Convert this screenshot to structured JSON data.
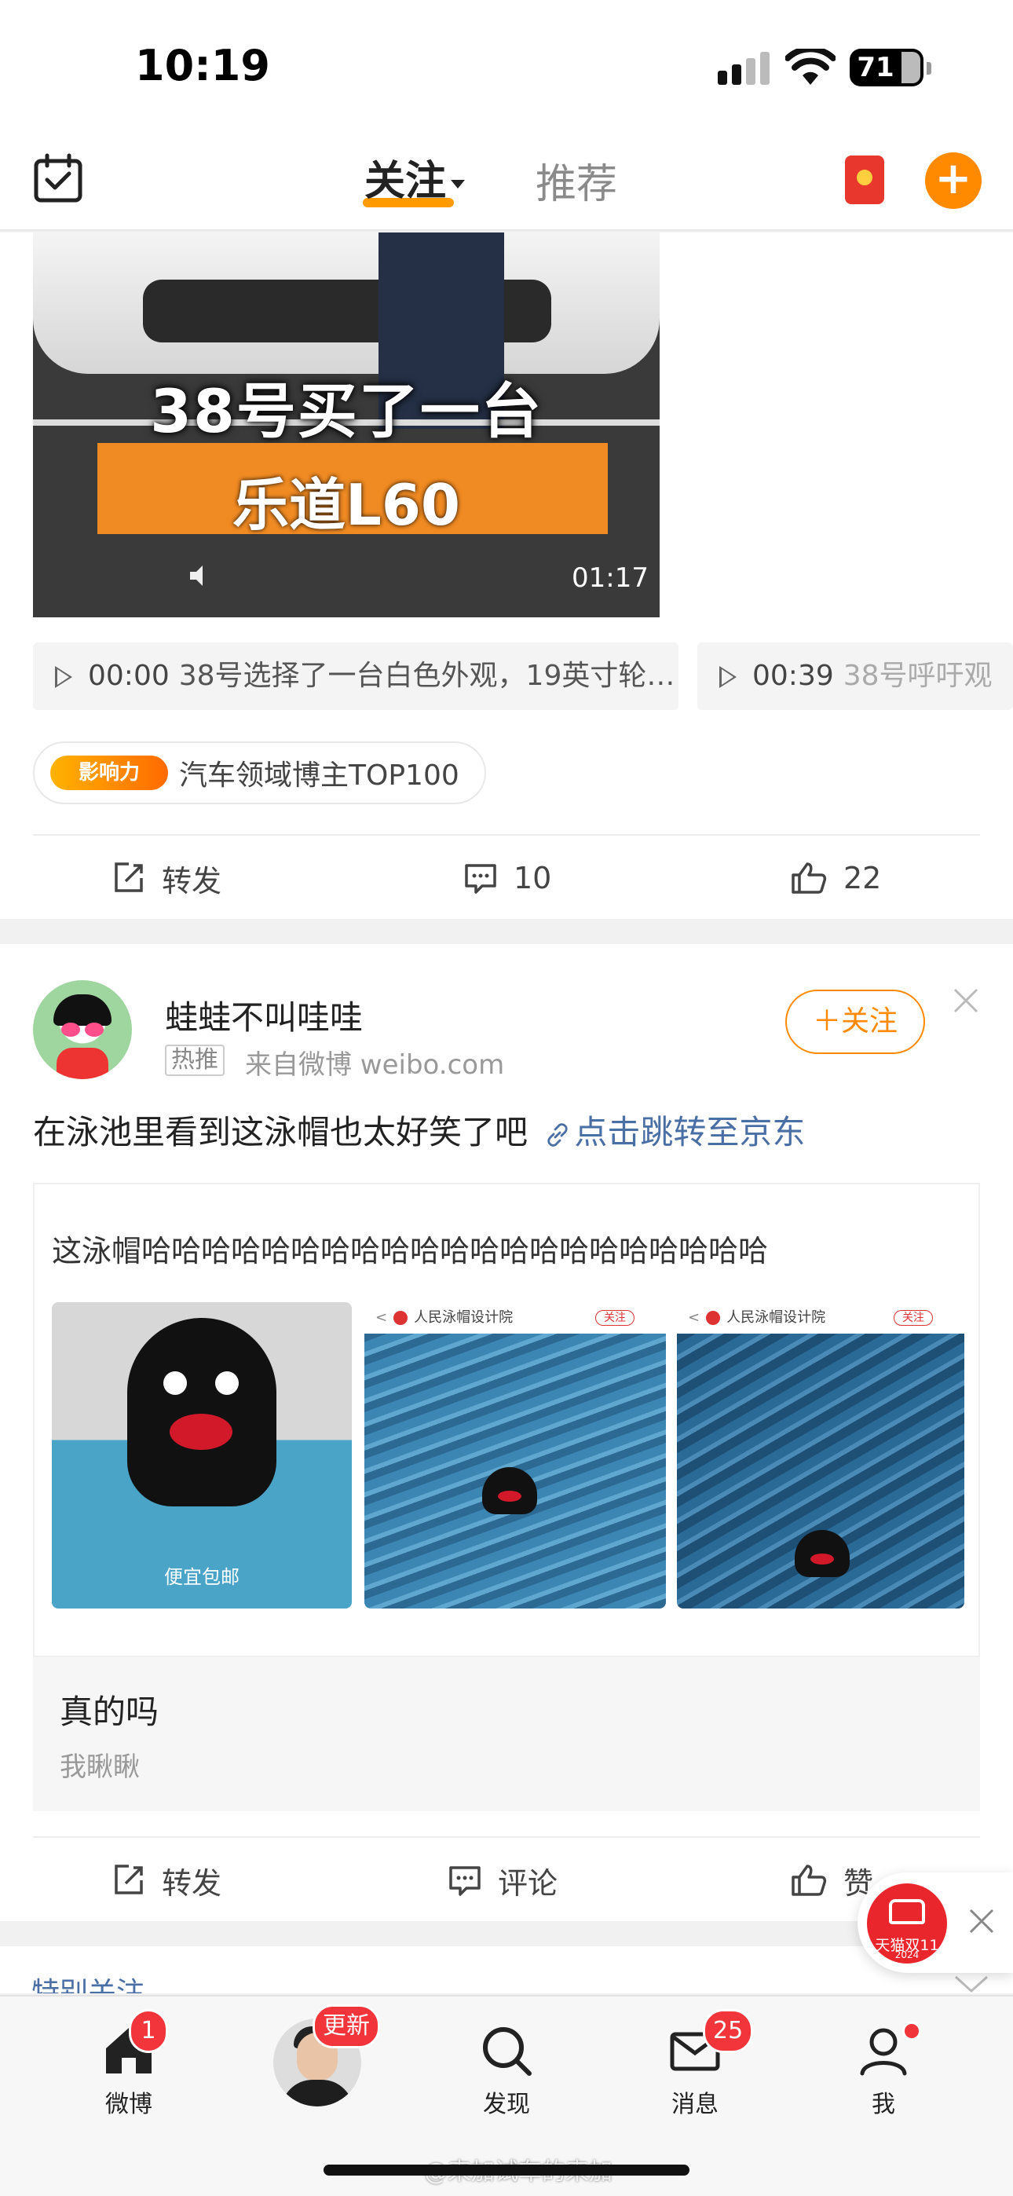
{
  "status_bar": {
    "time": "10:19",
    "battery": "71"
  },
  "top_nav": {
    "tab_follow": "关注",
    "tab_recommend": "推荐"
  },
  "post1": {
    "video": {
      "caption_line1": "38号买了一台",
      "caption_line2": "乐道L60",
      "duration": "01:17"
    },
    "chapters": [
      {
        "time": "00:00",
        "text": "38号选择了一台白色外观，19英寸轮…"
      },
      {
        "time": "00:39",
        "text": "38号呼吁观"
      }
    ],
    "badge": {
      "icon_text": "影响力",
      "label": "汽车领域博主TOP100"
    },
    "actions": {
      "repost": "转发",
      "comments": "10",
      "likes": "22"
    }
  },
  "post2": {
    "username": "蛙蛙不叫哇哇",
    "tag": "热推",
    "source": "来自微博 weibo.com",
    "follow_label": "＋关注",
    "text": "在泳池里看到这泳帽也太好笑了吧",
    "link_text": "点击跳转至京东",
    "preview": {
      "title": "这泳帽哈哈哈哈哈哈哈哈哈哈哈哈哈哈哈哈哈哈哈哈哈",
      "pic1_caption": "便宜包邮",
      "pic_header": "人民泳帽设计院",
      "pic_follow": "关注",
      "headline": "真的吗",
      "subline": "我瞅瞅"
    },
    "actions": {
      "repost": "转发",
      "comment": "评论",
      "like": "赞"
    }
  },
  "special_follow": {
    "label": "特别关注"
  },
  "promo": {
    "label": "天猫双11",
    "year": "2024"
  },
  "tab_bar": {
    "items": [
      {
        "label": "微博",
        "badge": "1"
      },
      {
        "label": "",
        "badge": "更新"
      },
      {
        "label": "发现",
        "badge": ""
      },
      {
        "label": "消息",
        "badge": "25"
      },
      {
        "label": "我",
        "badge": ""
      }
    ]
  },
  "watermark": "@来加试车的来加",
  "colors": {
    "accent": "#ff8a00",
    "link": "#4a6fa5",
    "badge_red": "#f2353b"
  }
}
